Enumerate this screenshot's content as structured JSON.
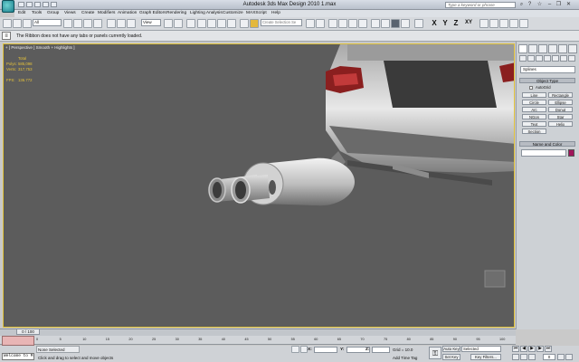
{
  "titlebar": {
    "title": "Autodesk 3ds Max Design 2010      1.max",
    "search_placeholder": "Type a keyword or phrase"
  },
  "menu": [
    "Edit",
    "Tools",
    "Group",
    "Views",
    "Create",
    "Modifiers",
    "Animation",
    "Graph Editors",
    "Rendering",
    "Lighting Analysis",
    "Customize",
    "MAXScript",
    "Help"
  ],
  "toolbar": {
    "filter": "All",
    "refcoord": "View",
    "selection_set": "Create Selection Se",
    "axis_x": "X",
    "axis_y": "Y",
    "axis_z": "Z",
    "axis_xy": "XY"
  },
  "ribbon": {
    "toggle": "≡",
    "message": "The Ribbon does not have any tabs or panels currently loaded."
  },
  "viewport": {
    "label": "+ ] Perspective ] Smooth + Highlights ]",
    "stats_total": "Total",
    "stats_polys_label": "Polys:",
    "stats_polys": "585,098",
    "stats_verts_label": "Verts:",
    "stats_verts": "317,753",
    "stats_fps_label": "FPS:",
    "stats_fps": "136.772"
  },
  "command_panel": {
    "category": "Splines",
    "object_type_header": "Object Type",
    "autogrid": "AutoGrid",
    "buttons": [
      "Line",
      "Rectangle",
      "Circle",
      "Ellipse",
      "Arc",
      "Donut",
      "NGon",
      "Star",
      "Text",
      "Helix",
      "Section"
    ],
    "name_color_header": "Name and Color",
    "color": "#a0145a"
  },
  "timeline": {
    "thumb": "0 / 100",
    "ticks": [
      "0",
      "5",
      "10",
      "15",
      "20",
      "25",
      "30",
      "35",
      "40",
      "45",
      "50",
      "55",
      "60",
      "65",
      "70",
      "75",
      "80",
      "85",
      "90",
      "95",
      "100"
    ]
  },
  "status": {
    "listener": "Welcome to M",
    "selection": "None Selected",
    "prompt": "Click and drag to select and move objects",
    "x_label": "X:",
    "y_label": "Y:",
    "z_label": "Z:",
    "grid": "Grid = 10.0",
    "time_tag": "Add Time Tag",
    "auto_key": "Auto Key",
    "set_key": "Set Key",
    "selected": "Selected",
    "key_filters": "Key Filters...",
    "frame": "0"
  }
}
